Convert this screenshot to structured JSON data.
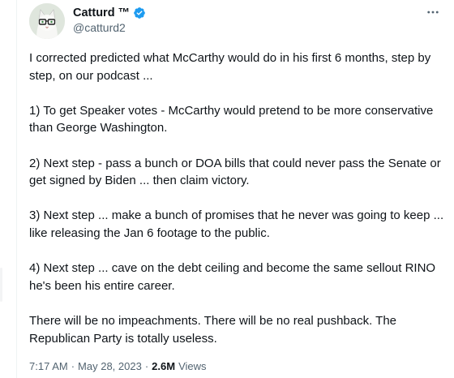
{
  "author": {
    "display_name": "Catturd ™",
    "handle": "@catturd2",
    "verified": true
  },
  "tweet": {
    "paragraphs": [
      "I corrected predicted what McCarthy would do in his first 6 months, step by step, on our podcast ...",
      "1) To get Speaker votes - McCarthy would pretend to be more conservative than George Washington.",
      "2) Next step - pass a bunch or DOA bills that could never pass the Senate or get signed by Biden ... then claim victory.",
      "3) Next step ... make a bunch of promises that he never was going to keep ... like releasing the Jan 6 footage to the public.",
      "4) Next step ... cave on the debt ceiling and become the same sellout RINO he's been his entire career.",
      "There will be no impeachments. There will be no real pushback. The Republican Party is totally useless."
    ]
  },
  "meta": {
    "time": "7:17 AM",
    "separator": "·",
    "date": "May 28, 2023",
    "views_count": "2.6M",
    "views_label": "Views"
  },
  "icons": {
    "verified": "verified-badge-icon",
    "more": "more-dots-icon"
  },
  "colors": {
    "verified_blue": "#1d9bf0",
    "text_primary": "#0f1419",
    "text_secondary": "#536471"
  }
}
